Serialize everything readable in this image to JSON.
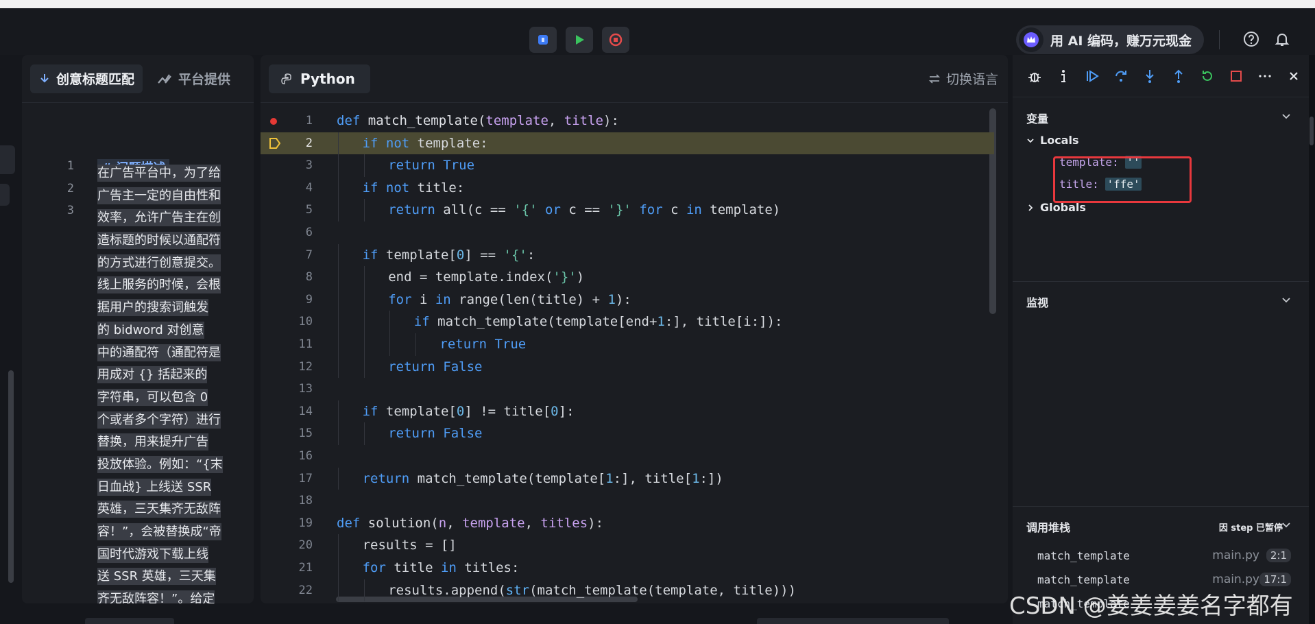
{
  "toolbar": {
    "ai_label": "用 AI 编码，赚万元现金",
    "colors": {
      "debug": "#3d7bf5",
      "run": "#3ac35e",
      "stop": "#e54b4b"
    }
  },
  "problem_panel": {
    "tab_active": "创意标题匹配",
    "tab_inactive": "平台提供",
    "line_numbers": [
      "1",
      "2",
      "3"
    ],
    "heading": "# 问题描述",
    "lines": [
      "在广告平台中，为了给",
      "广告主一定的自由性和",
      "效率，允许广告主在创",
      "造标题的时候以通配符",
      "的方式进行创意提交。",
      "线上服务的时候，会根",
      "据用户的搜索词触发",
      "的 bidword 对创意",
      "中的通配符（通配符是",
      "用成对 {} 括起来的",
      "字符串，可以包含 0",
      "个或者多个字符）进行",
      "替换，用来提升广告",
      "投放体验。例如：“{末",
      "日血战} 上线送 SSR",
      "英雄，三天集齐无敌阵",
      "容！”，会被替换成“帝",
      "国时代游戏下载上线",
      "送 SSR 英雄，三天集",
      "齐无敌阵容！”。给定"
    ]
  },
  "code_panel": {
    "language": "Python",
    "switch_label": "切换语言",
    "highlight_line": 2,
    "breakpoint_line": 1,
    "lines": [
      {
        "n": "1",
        "ind": 0,
        "html": "<span class='kw'>def</span> <span class='fn'>match_template</span>(<span class='par'>template</span>, <span class='par'>title</span>):"
      },
      {
        "n": "2",
        "ind": 1,
        "html": "<span class='kw'>if not</span> template:"
      },
      {
        "n": "3",
        "ind": 2,
        "html": "<span class='kw'>return True</span>"
      },
      {
        "n": "4",
        "ind": 1,
        "html": "<span class='kw'>if not</span> title:"
      },
      {
        "n": "5",
        "ind": 2,
        "html": "<span class='kw'>return</span> all(c == <span class='str'>'{'</span> <span class='kw'>or</span> c == <span class='str'>'}'</span> <span class='kw'>for</span> c <span class='kw'>in</span> template)"
      },
      {
        "n": "6",
        "ind": 0,
        "html": ""
      },
      {
        "n": "7",
        "ind": 1,
        "html": "<span class='kw'>if</span> template[<span class='num'>0</span>] == <span class='str'>'{'</span>:"
      },
      {
        "n": "8",
        "ind": 2,
        "html": "end = template.index(<span class='str'>'}'</span>)"
      },
      {
        "n": "9",
        "ind": 2,
        "html": "<span class='kw'>for</span> i <span class='kw'>in</span> range(len(title) + <span class='num'>1</span>):"
      },
      {
        "n": "10",
        "ind": 3,
        "html": "<span class='kw'>if</span> match_template(template[end+<span class='num'>1</span>:], title[i:]):"
      },
      {
        "n": "11",
        "ind": 4,
        "html": "<span class='kw'>return True</span>"
      },
      {
        "n": "12",
        "ind": 2,
        "html": "<span class='kw'>return False</span>"
      },
      {
        "n": "13",
        "ind": 0,
        "html": ""
      },
      {
        "n": "14",
        "ind": 1,
        "html": "<span class='kw'>if</span> template[<span class='num'>0</span>] != title[<span class='num'>0</span>]:"
      },
      {
        "n": "15",
        "ind": 2,
        "html": "<span class='kw'>return False</span>"
      },
      {
        "n": "16",
        "ind": 0,
        "html": ""
      },
      {
        "n": "17",
        "ind": 1,
        "html": "<span class='kw'>return</span> match_template(template[<span class='num'>1</span>:], title[<span class='num'>1</span>:])"
      },
      {
        "n": "18",
        "ind": 0,
        "html": ""
      },
      {
        "n": "19",
        "ind": 0,
        "html": "<span class='kw'>def</span> <span class='fn'>solution</span>(<span class='par'>n</span>, <span class='par'>template</span>, <span class='par'>titles</span>):"
      },
      {
        "n": "20",
        "ind": 1,
        "html": "results = []"
      },
      {
        "n": "21",
        "ind": 1,
        "html": "<span class='kw'>for</span> title <span class='kw'>in</span> titles:"
      },
      {
        "n": "22",
        "ind": 2,
        "html": "results.append(<span class='bi'>str</span>(match_template(template, title)))"
      }
    ]
  },
  "debugger": {
    "variables_title": "变量",
    "locals_label": "Locals",
    "globals_label": "Globals",
    "locals": [
      {
        "key": "template:",
        "value": "''"
      },
      {
        "key": "title:",
        "value": "'ffe'"
      }
    ],
    "watch_title": "监视",
    "callstack_title": "调用堆栈",
    "paused_label": "因 step 已暂停",
    "frames": [
      {
        "fn": "match_template",
        "file": "main.py",
        "pos": "2:1"
      },
      {
        "fn": "match_template",
        "file": "main.py",
        "pos": "17:1"
      },
      {
        "fn": "match_template",
        "file": "",
        "pos": ""
      }
    ]
  },
  "watermark": "CSDN @姜姜姜姜名字都有"
}
